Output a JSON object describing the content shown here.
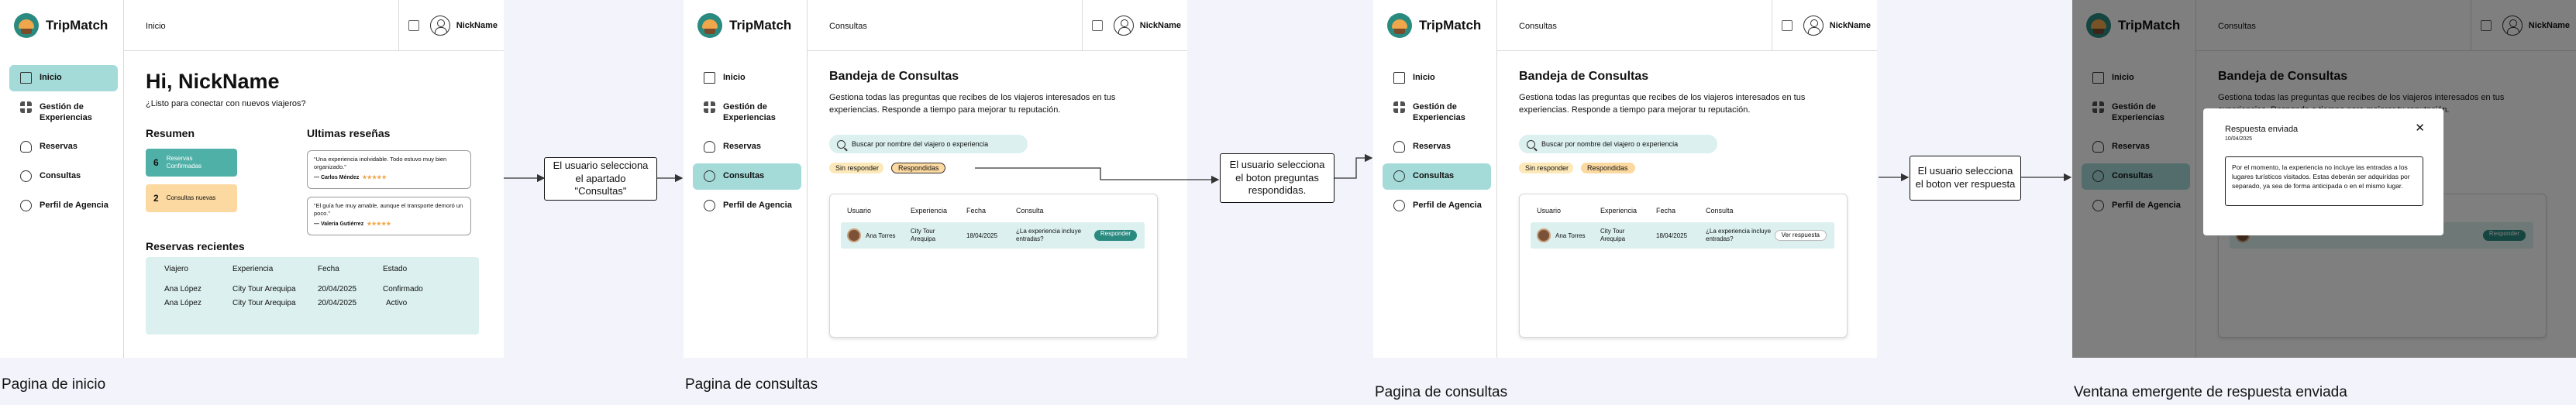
{
  "app": {
    "logo_text": "TripMatch",
    "user_name": "NickName"
  },
  "colors": {
    "accent_teal": "#2a8a80",
    "light_teal": "#dbf0ef",
    "active_nav": "#a4dbd8",
    "chip_yellow": "#fce8b8",
    "kpi_green": "#4fb0a8",
    "kpi_orange": "#fcd9a0"
  },
  "sidebar": {
    "items": [
      {
        "label": "Inicio",
        "icon": "house-icon"
      },
      {
        "label": "Gestión de Experiencias",
        "icon": "grid-icon"
      },
      {
        "label": "Reservas",
        "icon": "hand-icon"
      },
      {
        "label": "Consultas",
        "icon": "chat-icon"
      },
      {
        "label": "Perfil de Agencia",
        "icon": "user-icon"
      }
    ]
  },
  "home": {
    "page_title": "Inicio",
    "greeting": "Hi, NickName",
    "subtitle": "¿Listo para conectar con nuevos viajeros?",
    "summary_title": "Resumen",
    "kpis": [
      {
        "value": "6",
        "label": "Reservas Confirmadas"
      },
      {
        "value": "2",
        "label": "Consultas nuevas"
      }
    ],
    "reviews_title": "Ultimas reseñas",
    "reviews": [
      {
        "text": "“Una experiencia inolvidable. Todo estuvo muy bien organizado.”",
        "author": "— Carlos Méndez",
        "stars": "★★★★★"
      },
      {
        "text": "“El guía fue muy amable, aunque el transporte demoró un poco.”",
        "author": "— Valeria Gutiérrez",
        "stars": "★★★★★"
      }
    ],
    "recent_title": "Reservas recientes",
    "table": {
      "headers": [
        "Viajero",
        "Experiencia",
        "Fecha",
        "Estado"
      ],
      "rows": [
        [
          "Ana López",
          "City Tour Arequipa",
          "20/04/2025",
          "Confirmado"
        ],
        [
          "Ana López",
          "City Tour Arequipa",
          "20/04/2025",
          "Activo"
        ]
      ]
    }
  },
  "consultas": {
    "page_title": "Consultas",
    "title": "Bandeja de Consultas",
    "description": "Gestiona todas las preguntas que recibes de los viajeros interesados en tus experiencias. Responde a tiempo para mejorar tu reputación.",
    "search_placeholder": "Buscar por nombre del viajero o experiencia",
    "filters": [
      "Sin responder",
      "Respondidas"
    ],
    "table_headers": [
      "Usuario",
      "Experiencia",
      "Fecha",
      "Consulta"
    ],
    "row": {
      "user": "Ana Torres",
      "experience": "City Tour Arequipa",
      "date": "18/04/2025",
      "question": "¿La experiencia incluye entradas?"
    },
    "reply_button": "Responder",
    "view_reply_button": "Ver respuesta"
  },
  "modal": {
    "title": "Respuesta enviada",
    "date": "10/04/2025",
    "close": "✕",
    "text": "Por el momento, la experiencia no incluye las entradas a los lugares turísticos visitados. Estas deberán ser adquiridas por separado, ya sea de forma anticipada o en el mismo lugar."
  },
  "flow": {
    "step1": "El usuario selecciona el apartado \"Consultas\"",
    "step2": "El usuario selecciona el boton preguntas respondidas.",
    "step3": "El usuario selecciona el boton ver respuesta"
  },
  "captions": {
    "home": "Pagina de inicio",
    "consultas1": "Pagina de consultas",
    "consultas2": "Pagina de consultas",
    "modal": "Ventana emergente de respuesta enviada"
  }
}
